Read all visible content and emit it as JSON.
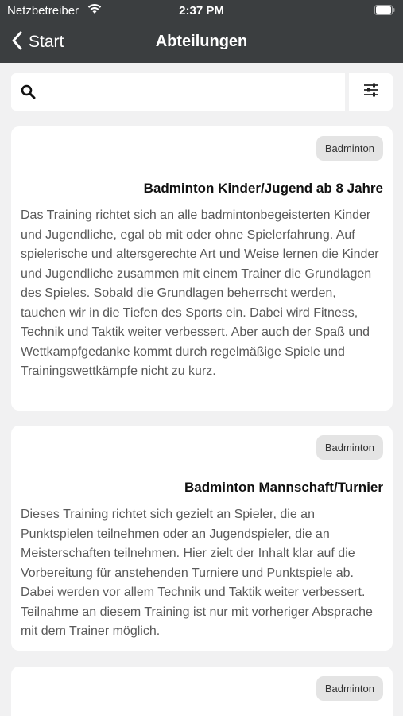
{
  "status_bar": {
    "carrier": "Netzbetreiber",
    "time": "2:37 PM"
  },
  "nav": {
    "back_label": "Start",
    "title": "Abteilungen"
  },
  "search": {
    "placeholder": "",
    "value": ""
  },
  "cards": [
    {
      "badge": "Badminton",
      "title": "Badminton Kinder/Jugend ab 8 Jahre",
      "description": "Das Training richtet sich an alle badmintonbegeisterten Kinder und Jugendliche, egal ob mit oder ohne Spielerfahrung. Auf spielerische und altersgerechte Art und Weise lernen die Kinder und Jugendliche zusammen mit einem Trainer die Grundlagen des Spieles. Sobald die Grundlagen beherrscht werden, tauchen wir in die Tiefen des Sports ein. Dabei wird Fitness, Technik und Taktik weiter verbessert. Aber auch der Spaß und Wettkampfgedanke kommt durch regelmäßige Spiele und Trainingswettkämpfe nicht zu kurz."
    },
    {
      "badge": "Badminton",
      "title": "Badminton Mannschaft/Turnier",
      "description": "Dieses Training richtet sich gezielt an Spieler, die an Punktspielen teilnehmen oder an Jugendspieler, die an Meisterschaften teilnehmen. Hier zielt der Inhalt klar auf die Vorbereitung für anstehenden Turniere und Punktspiele ab. Dabei werden vor allem Technik und Taktik weiter verbessert. Teilnahme an diesem Training ist nur mit vorheriger Absprache mit dem Trainer möglich."
    },
    {
      "badge": "Badminton"
    }
  ]
}
